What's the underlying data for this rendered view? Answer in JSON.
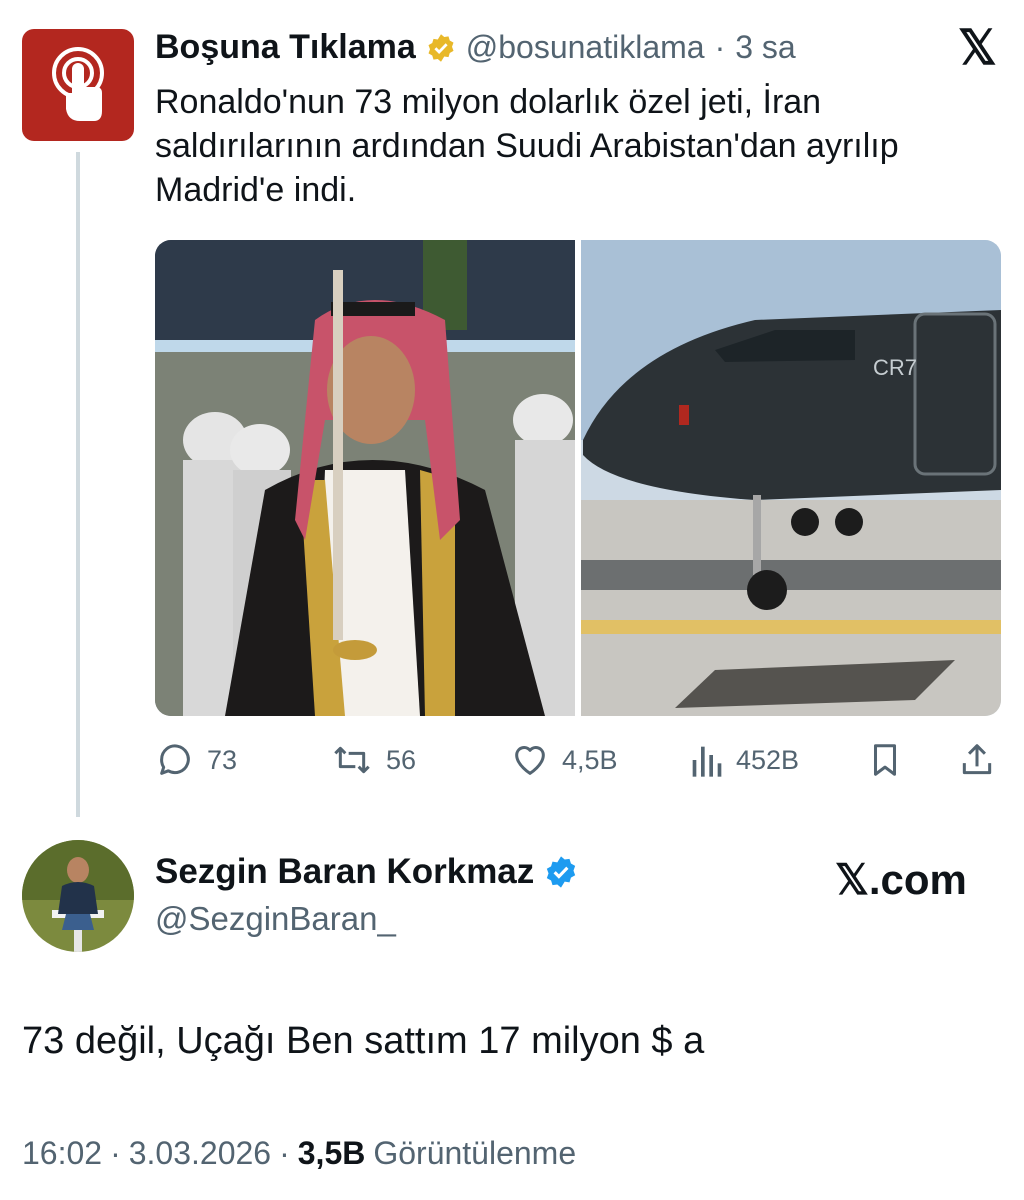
{
  "quoted": {
    "author_name": "Boşuna Tıklama",
    "handle": "@bosunatiklama",
    "separator": "·",
    "time": "3 sa",
    "text_lines": [
      "Ronaldo'nun 73 milyon dolarlık özel jeti, İran",
      "saldırılarının ardından Suudi Arabistan'dan ayrılıp",
      "Madrid'e indi."
    ],
    "jet_text": "CR7",
    "stats": {
      "replies": "73",
      "reposts": "56",
      "likes": "4,5B",
      "views": "452B"
    }
  },
  "post": {
    "author_name": "Sezgin Baran Korkmaz",
    "handle": "@SezginBaran_",
    "brand": "𝕏.com",
    "text": "73 değil, Uçağı Ben sattım 17 milyon $ a",
    "time": "16:02",
    "sep1": "·",
    "date": "3.03.2026",
    "sep2": "·",
    "views_count": "3,5B",
    "views_label": "Görüntülenme"
  },
  "icons": {
    "x_logo": "𝕏"
  },
  "colors": {
    "verified_gold": "#e8b829",
    "verified_blue": "#1d9bf0",
    "brand_red": "#b3271f",
    "secondary_text": "#536471"
  }
}
